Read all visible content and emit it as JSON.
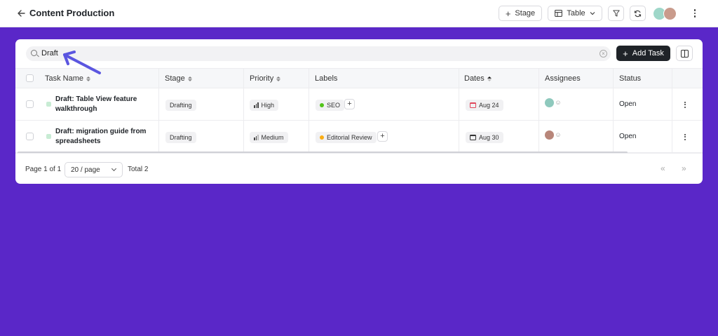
{
  "header": {
    "title": "Content Production",
    "stage_button": "Stage",
    "view_button": "Table"
  },
  "search": {
    "value": "Draft"
  },
  "toolbar": {
    "add_task_label": "Add Task"
  },
  "table": {
    "columns": [
      "Task Name",
      "Stage",
      "Priority",
      "Labels",
      "Dates",
      "Assignees",
      "Status"
    ],
    "rows": [
      {
        "task_name": "Draft: Table View feature walkthrough",
        "stage": "Drafting",
        "priority": "High",
        "label": "SEO",
        "label_color": "#52c41a",
        "date": "Aug 24",
        "date_color": "#e0455a",
        "status": "Open"
      },
      {
        "task_name": "Draft: migration guide from spreadsheets",
        "stage": "Drafting",
        "priority": "Medium",
        "label": "Editorial Review",
        "label_color": "#faad14",
        "date": "Aug 30",
        "date_color": "#333333",
        "status": "Open"
      }
    ]
  },
  "footer": {
    "page_text": "Page 1 of 1",
    "per_page": "20 / page",
    "total": "Total 2",
    "prev": "«",
    "next": "»"
  },
  "colors": {
    "background": "#5a27c8",
    "annotation_arrow": "#5b56e0"
  }
}
